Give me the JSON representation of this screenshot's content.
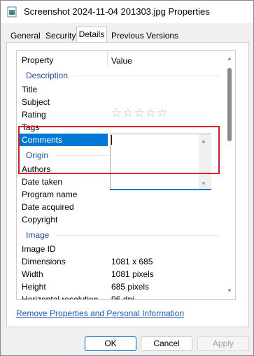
{
  "window": {
    "title": "Screenshot 2024-11-04 201303.jpg Properties"
  },
  "tabs": [
    {
      "label": "General"
    },
    {
      "label": "Security"
    },
    {
      "label": "Details",
      "active": true
    },
    {
      "label": "Previous Versions"
    }
  ],
  "properties": {
    "header_property": "Property",
    "header_value": "Value",
    "sections": {
      "description": "Description",
      "origin": "Origin",
      "image": "Image"
    },
    "rows": {
      "title": {
        "label": "Title",
        "value": ""
      },
      "subject": {
        "label": "Subject",
        "value": ""
      },
      "rating": {
        "label": "Rating",
        "value": "☆☆☆☆☆"
      },
      "tags": {
        "label": "Tags",
        "value": ""
      },
      "comments": {
        "label": "Comments",
        "value": ""
      },
      "authors": {
        "label": "Authors",
        "value": ""
      },
      "date_taken": {
        "label": "Date taken",
        "value": ""
      },
      "program_name": {
        "label": "Program name",
        "value": ""
      },
      "date_acquired": {
        "label": "Date acquired",
        "value": ""
      },
      "copyright": {
        "label": "Copyright",
        "value": ""
      },
      "image_id": {
        "label": "Image ID",
        "value": ""
      },
      "dimensions": {
        "label": "Dimensions",
        "value": "1081 x 685"
      },
      "width": {
        "label": "Width",
        "value": "1081 pixels"
      },
      "height": {
        "label": "Height",
        "value": "685 pixels"
      },
      "horizontal_resolution": {
        "label": "Horizontal resolution",
        "value": "96 dpi"
      }
    }
  },
  "link": {
    "label": "Remove Properties and Personal Information"
  },
  "buttons": {
    "ok": "OK",
    "cancel": "Cancel",
    "apply": "Apply"
  },
  "colors": {
    "selection": "#0078d7",
    "section_text": "#1d4ea4",
    "highlight_annotation": "#e8152b",
    "link": "#1b5fb8"
  }
}
